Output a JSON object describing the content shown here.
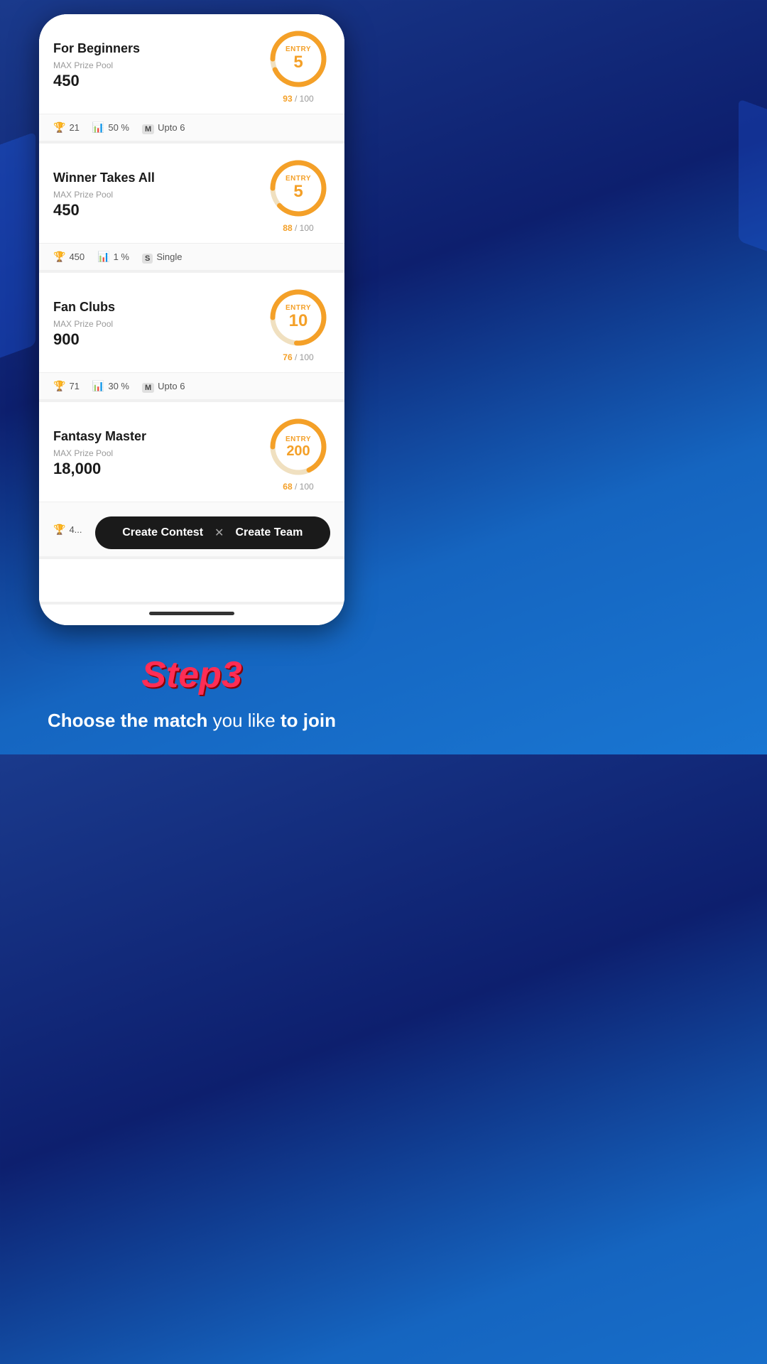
{
  "contests": [
    {
      "id": "for-beginners",
      "name": "For Beginners",
      "prize_label": "MAX Prize Pool",
      "prize_value": "450",
      "entry_label": "Entry",
      "entry_value": "5",
      "entry_filled": 93,
      "entry_total": 100,
      "stats": [
        {
          "icon": "trophy",
          "value": "21"
        },
        {
          "icon": "bar",
          "value": "50 %"
        },
        {
          "icon": "multi",
          "value": "Upto 6"
        }
      ]
    },
    {
      "id": "winner-takes-all",
      "name": "Winner Takes All",
      "prize_label": "MAX Prize Pool",
      "prize_value": "450",
      "entry_label": "Entry",
      "entry_value": "5",
      "entry_filled": 88,
      "entry_total": 100,
      "stats": [
        {
          "icon": "trophy",
          "value": "450"
        },
        {
          "icon": "bar",
          "value": "1 %"
        },
        {
          "icon": "single",
          "value": "Single"
        }
      ]
    },
    {
      "id": "fan-clubs",
      "name": "Fan Clubs",
      "prize_label": "MAX Prize Pool",
      "prize_value": "900",
      "entry_label": "Entry",
      "entry_value": "10",
      "entry_filled": 76,
      "entry_total": 100,
      "stats": [
        {
          "icon": "trophy",
          "value": "71"
        },
        {
          "icon": "bar",
          "value": "30 %"
        },
        {
          "icon": "multi",
          "value": "Upto 6"
        }
      ]
    },
    {
      "id": "fantasy-master",
      "name": "Fantasy Master",
      "prize_label": "MAX Prize Pool",
      "prize_value": "18,000",
      "entry_label": "Entry",
      "entry_value": "200",
      "entry_filled": 68,
      "entry_total": 100,
      "stats": [
        {
          "icon": "trophy",
          "value": "4..."
        },
        {
          "icon": "bar",
          "value": ""
        },
        {
          "icon": "multi",
          "value": ""
        }
      ]
    }
  ],
  "action_bar": {
    "create_contest": "Create Contest",
    "divider": "✕",
    "create_team": "Create Team"
  },
  "bottom": {
    "step_title": "Step3",
    "subtitle_bold1": "Choose the match",
    "subtitle_normal": " you like ",
    "subtitle_bold2": "to join"
  }
}
